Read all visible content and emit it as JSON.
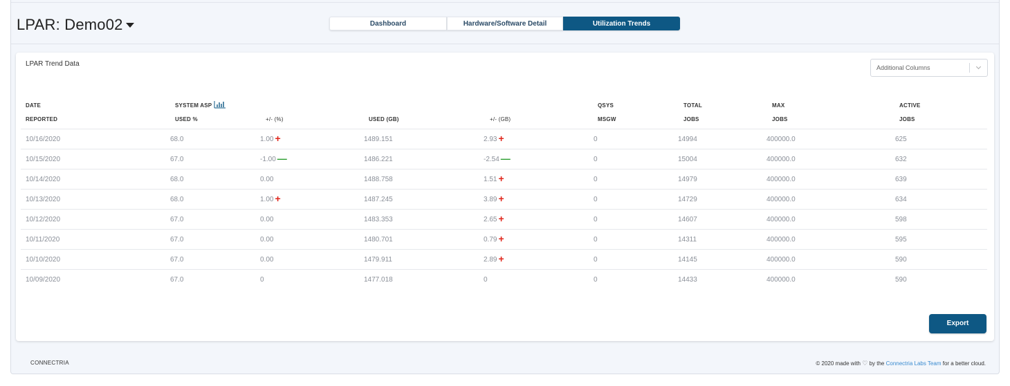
{
  "header": {
    "title": "LPAR: Demo02",
    "tabs": [
      {
        "label": "Dashboard",
        "active": false
      },
      {
        "label": "Hardware/Software Detail",
        "active": false
      },
      {
        "label": "Utilization Trends",
        "active": true
      }
    ]
  },
  "card": {
    "title": "LPAR Trend Data",
    "additional_columns": {
      "placeholder": "Additional Columns"
    },
    "columns": [
      {
        "line1": "DATE",
        "line2": "REPORTED"
      },
      {
        "line1": "SYSTEM ASP",
        "line2": "USED %"
      },
      {
        "line1": "",
        "line2": "+/- (%)"
      },
      {
        "line1": "",
        "line2": "USED (GB)"
      },
      {
        "line1": "",
        "line2": "+/- (GB)"
      },
      {
        "line1": "QSYS",
        "line2": "MSGW"
      },
      {
        "line1": "TOTAL",
        "line2": "JOBS"
      },
      {
        "line1": "MAX",
        "line2": "JOBS"
      },
      {
        "line1": "ACTIVE",
        "line2": "JOBS"
      }
    ],
    "rows": [
      {
        "date": "10/16/2020",
        "used_pct": "68.0",
        "chg_pct": "1.00",
        "chg_pct_dir": "up",
        "used_gb": "1489.151",
        "chg_gb": "2.93",
        "chg_gb_dir": "up",
        "msgw": "0",
        "total_jobs": "14994",
        "max_jobs": "400000.0",
        "active_jobs": "625"
      },
      {
        "date": "10/15/2020",
        "used_pct": "67.0",
        "chg_pct": "-1.00",
        "chg_pct_dir": "down",
        "used_gb": "1486.221",
        "chg_gb": "-2.54",
        "chg_gb_dir": "down",
        "msgw": "0",
        "total_jobs": "15004",
        "max_jobs": "400000.0",
        "active_jobs": "632"
      },
      {
        "date": "10/14/2020",
        "used_pct": "68.0",
        "chg_pct": "0.00",
        "chg_pct_dir": "none",
        "used_gb": "1488.758",
        "chg_gb": "1.51",
        "chg_gb_dir": "up",
        "msgw": "0",
        "total_jobs": "14979",
        "max_jobs": "400000.0",
        "active_jobs": "639"
      },
      {
        "date": "10/13/2020",
        "used_pct": "68.0",
        "chg_pct": "1.00",
        "chg_pct_dir": "up",
        "used_gb": "1487.245",
        "chg_gb": "3.89",
        "chg_gb_dir": "up",
        "msgw": "0",
        "total_jobs": "14729",
        "max_jobs": "400000.0",
        "active_jobs": "634"
      },
      {
        "date": "10/12/2020",
        "used_pct": "67.0",
        "chg_pct": "0.00",
        "chg_pct_dir": "none",
        "used_gb": "1483.353",
        "chg_gb": "2.65",
        "chg_gb_dir": "up",
        "msgw": "0",
        "total_jobs": "14607",
        "max_jobs": "400000.0",
        "active_jobs": "598"
      },
      {
        "date": "10/11/2020",
        "used_pct": "67.0",
        "chg_pct": "0.00",
        "chg_pct_dir": "none",
        "used_gb": "1480.701",
        "chg_gb": "0.79",
        "chg_gb_dir": "up",
        "msgw": "0",
        "total_jobs": "14311",
        "max_jobs": "400000.0",
        "active_jobs": "595"
      },
      {
        "date": "10/10/2020",
        "used_pct": "67.0",
        "chg_pct": "0.00",
        "chg_pct_dir": "none",
        "used_gb": "1479.911",
        "chg_gb": "2.89",
        "chg_gb_dir": "up",
        "msgw": "0",
        "total_jobs": "14145",
        "max_jobs": "400000.0",
        "active_jobs": "590"
      },
      {
        "date": "10/09/2020",
        "used_pct": "67.0",
        "chg_pct": "0",
        "chg_pct_dir": "none",
        "used_gb": "1477.018",
        "chg_gb": "0",
        "chg_gb_dir": "none",
        "msgw": "0",
        "total_jobs": "14433",
        "max_jobs": "400000.0",
        "active_jobs": "590"
      }
    ],
    "export_label": "Export"
  },
  "footer": {
    "brand": "CONNECTRIA",
    "credit_prefix": "© 2020 made with",
    "credit_by": "by the",
    "credit_link": "Connectria Labs Team",
    "credit_suffix": "for a better cloud."
  },
  "colors": {
    "accent": "#0e5884",
    "up": "#e0261b",
    "down": "#2a9d2e",
    "link": "#3a8bd0"
  }
}
